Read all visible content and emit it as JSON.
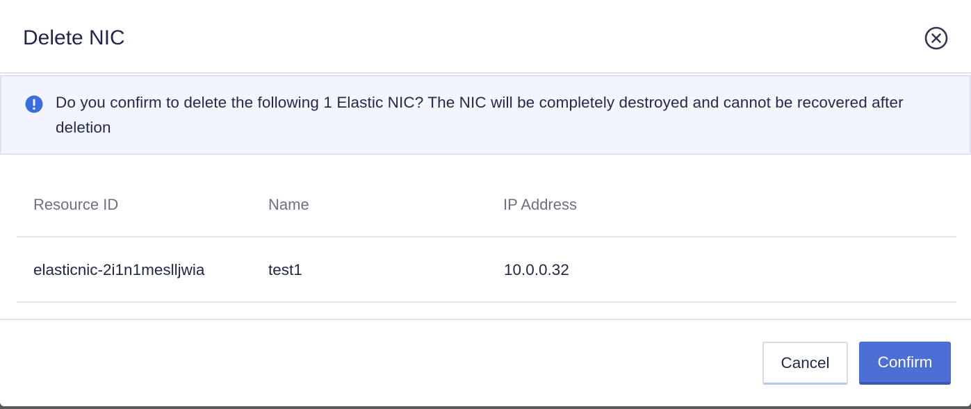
{
  "dialog": {
    "title": "Delete NIC",
    "close_icon": "close-circle-icon"
  },
  "alert": {
    "icon": "info-exclamation-icon",
    "message": "Do you confirm to delete the following 1 Elastic NIC? The NIC will be completely destroyed and cannot be recovered after deletion",
    "icon_color": "#3b6de0"
  },
  "table": {
    "columns": [
      "Resource ID",
      "Name",
      "IP Address"
    ],
    "rows": [
      [
        "elasticnic-2i1n1meslljwia",
        "test1",
        "10.0.0.32"
      ]
    ]
  },
  "footer": {
    "cancel_label": "Cancel",
    "confirm_label": "Confirm",
    "confirm_color": "#4c6fd6"
  }
}
